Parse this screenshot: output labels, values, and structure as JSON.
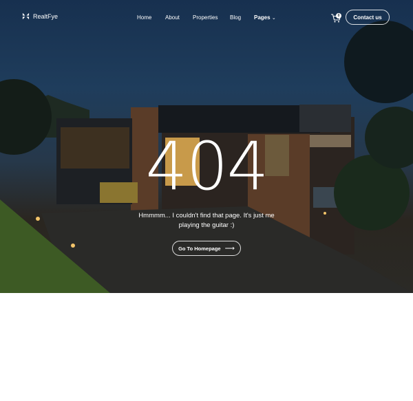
{
  "brand": {
    "name": "RealtFye",
    "logo_icon": "leaf-cross-logo-icon"
  },
  "nav": {
    "items": [
      {
        "label": "Home"
      },
      {
        "label": "About"
      },
      {
        "label": "Properties"
      },
      {
        "label": "Blog"
      },
      {
        "label": "Pages",
        "has_dropdown": true
      }
    ],
    "cart_count": "0",
    "cart_icon": "cart-icon",
    "contact_label": "Contact us"
  },
  "error": {
    "code": "404",
    "message": "Hmmmm... I couldn't find that page. It's just me playing the guitar :)",
    "button_label": "Go To Homepage",
    "button_icon": "arrow-right-icon"
  },
  "colors": {
    "hero_sky": "#1f3d5c",
    "text": "#ffffff",
    "page_bg": "#ffffff"
  }
}
